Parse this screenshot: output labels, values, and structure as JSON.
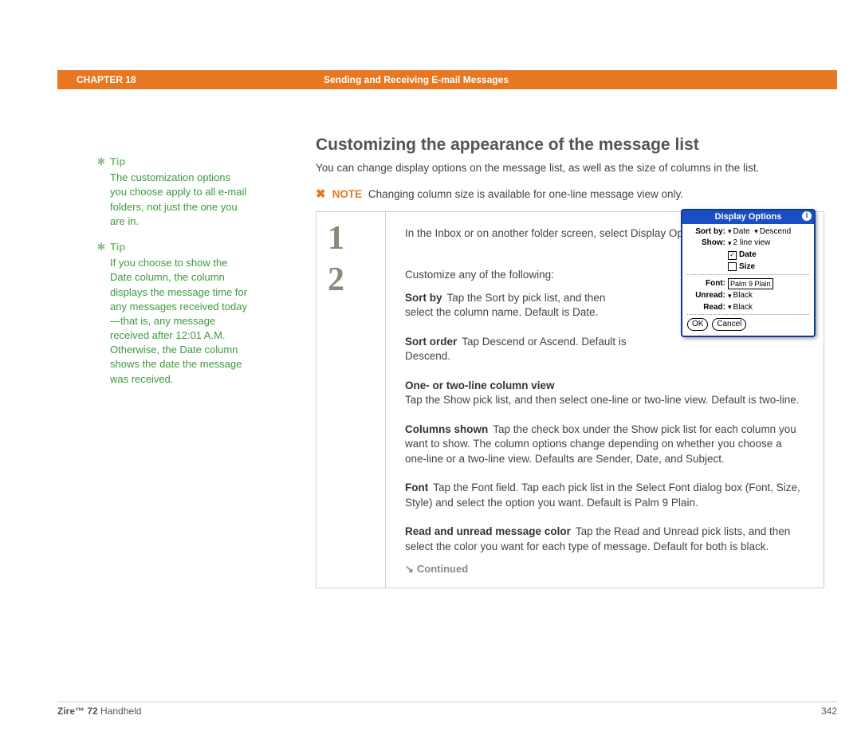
{
  "header": {
    "chapter": "CHAPTER 18",
    "section": "Sending and Receiving E-mail Messages"
  },
  "sidebar": {
    "tip1": {
      "label": "Tip",
      "body": "The customization options you choose apply to all e-mail folders, not just the one you are in."
    },
    "tip2": {
      "label": "Tip",
      "body": "If you choose to show the Date column, the column displays the message time for any messages received today—that is, any message received after 12:01 A.M. Otherwise, the Date column shows the date the message was received."
    }
  },
  "main": {
    "heading": "Customizing the appearance of the message list",
    "intro": "You can change display options on the message list, as well as the size of columns in the list.",
    "note_label": "NOTE",
    "note_text": "Changing column size is available for one-line message view only.",
    "step_nums": {
      "one": "1",
      "two": "2"
    },
    "step1": "In the Inbox or on another folder screen, select Display Options.",
    "step2_lead": "Customize any of the following:",
    "sortby_lead": "Sort by",
    "sortby_text": "Tap the Sort by pick list, and then select the column name. Default is Date.",
    "sortorder_lead": "Sort order",
    "sortorder_text": "Tap Descend or Ascend. Default is Descend.",
    "view_lead": "One- or two-line column view",
    "view_text": "Tap the Show pick list, and then select one-line or two-line view. Default is two-line.",
    "columns_lead": "Columns shown",
    "columns_text": "Tap the check box under the Show pick list for each column you want to show. The column options change depending on whether you choose a one-line or a two-line view. Defaults are Sender, Date, and Subject.",
    "font_lead": "Font",
    "font_text": "Tap the Font field. Tap each pick list in the Select Font dialog box (Font, Size, Style) and select the option you want. Default is Palm 9 Plain.",
    "color_lead": "Read and unread message color",
    "color_text": "Tap the Read and Unread pick lists, and then select the color you want for each type of message. Default for both is black.",
    "continued": "Continued"
  },
  "device": {
    "title": "Display Options",
    "sortby_lbl": "Sort by:",
    "sortby_v1": "Date",
    "sortby_v2": "Descend",
    "show_lbl": "Show:",
    "show_v": "2 line view",
    "chk1": "Date",
    "chk2": "Size",
    "font_lbl": "Font:",
    "font_v": "Palm 9 Plain",
    "unread_lbl": "Unread:",
    "unread_v": "Black",
    "read_lbl": "Read:",
    "read_v": "Black",
    "ok": "OK",
    "cancel": "Cancel"
  },
  "footer": {
    "product_bold": "Zire™ 72",
    "product_rest": " Handheld",
    "page": "342"
  }
}
